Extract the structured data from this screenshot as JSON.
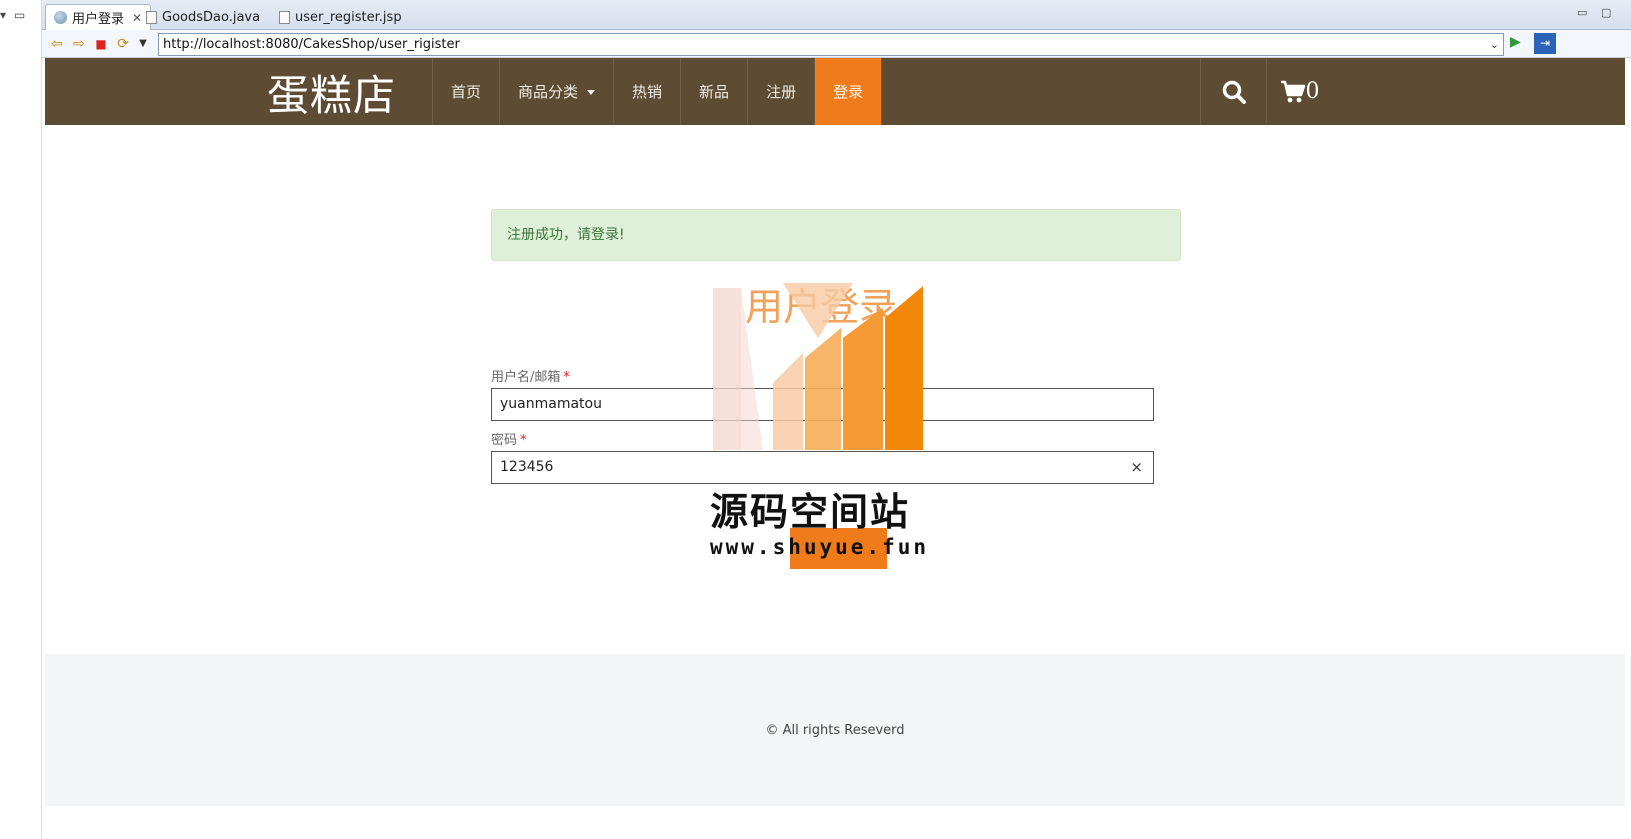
{
  "ide": {
    "tabs": [
      {
        "label": "用户登录",
        "active": true
      },
      {
        "label": "GoodsDao.java",
        "active": false
      },
      {
        "label": "user_register.jsp",
        "active": false
      }
    ],
    "url": "http://localhost:8080/CakesShop/user_rigister"
  },
  "site": {
    "brand": "蛋糕店",
    "nav": [
      {
        "label": "首页"
      },
      {
        "label": "商品分类"
      },
      {
        "label": "热销"
      },
      {
        "label": "新品"
      },
      {
        "label": "注册"
      },
      {
        "label": "登录",
        "active": true
      }
    ],
    "cart_count": "0",
    "accent_color": "#ef7b1b",
    "header_color": "#5d4b33"
  },
  "login": {
    "alert": "注册成功，请登录!",
    "title": "用户登录",
    "username_label": "用户名/邮箱",
    "username_value": "yuanmamatou",
    "password_label": "密码",
    "password_value": "123456",
    "required_mark": "*",
    "clear_icon": "×"
  },
  "watermark": {
    "text": "源码空间站",
    "url": "www.shuyue.fun"
  },
  "footer": {
    "copyright": "© All rights Reseverd"
  }
}
